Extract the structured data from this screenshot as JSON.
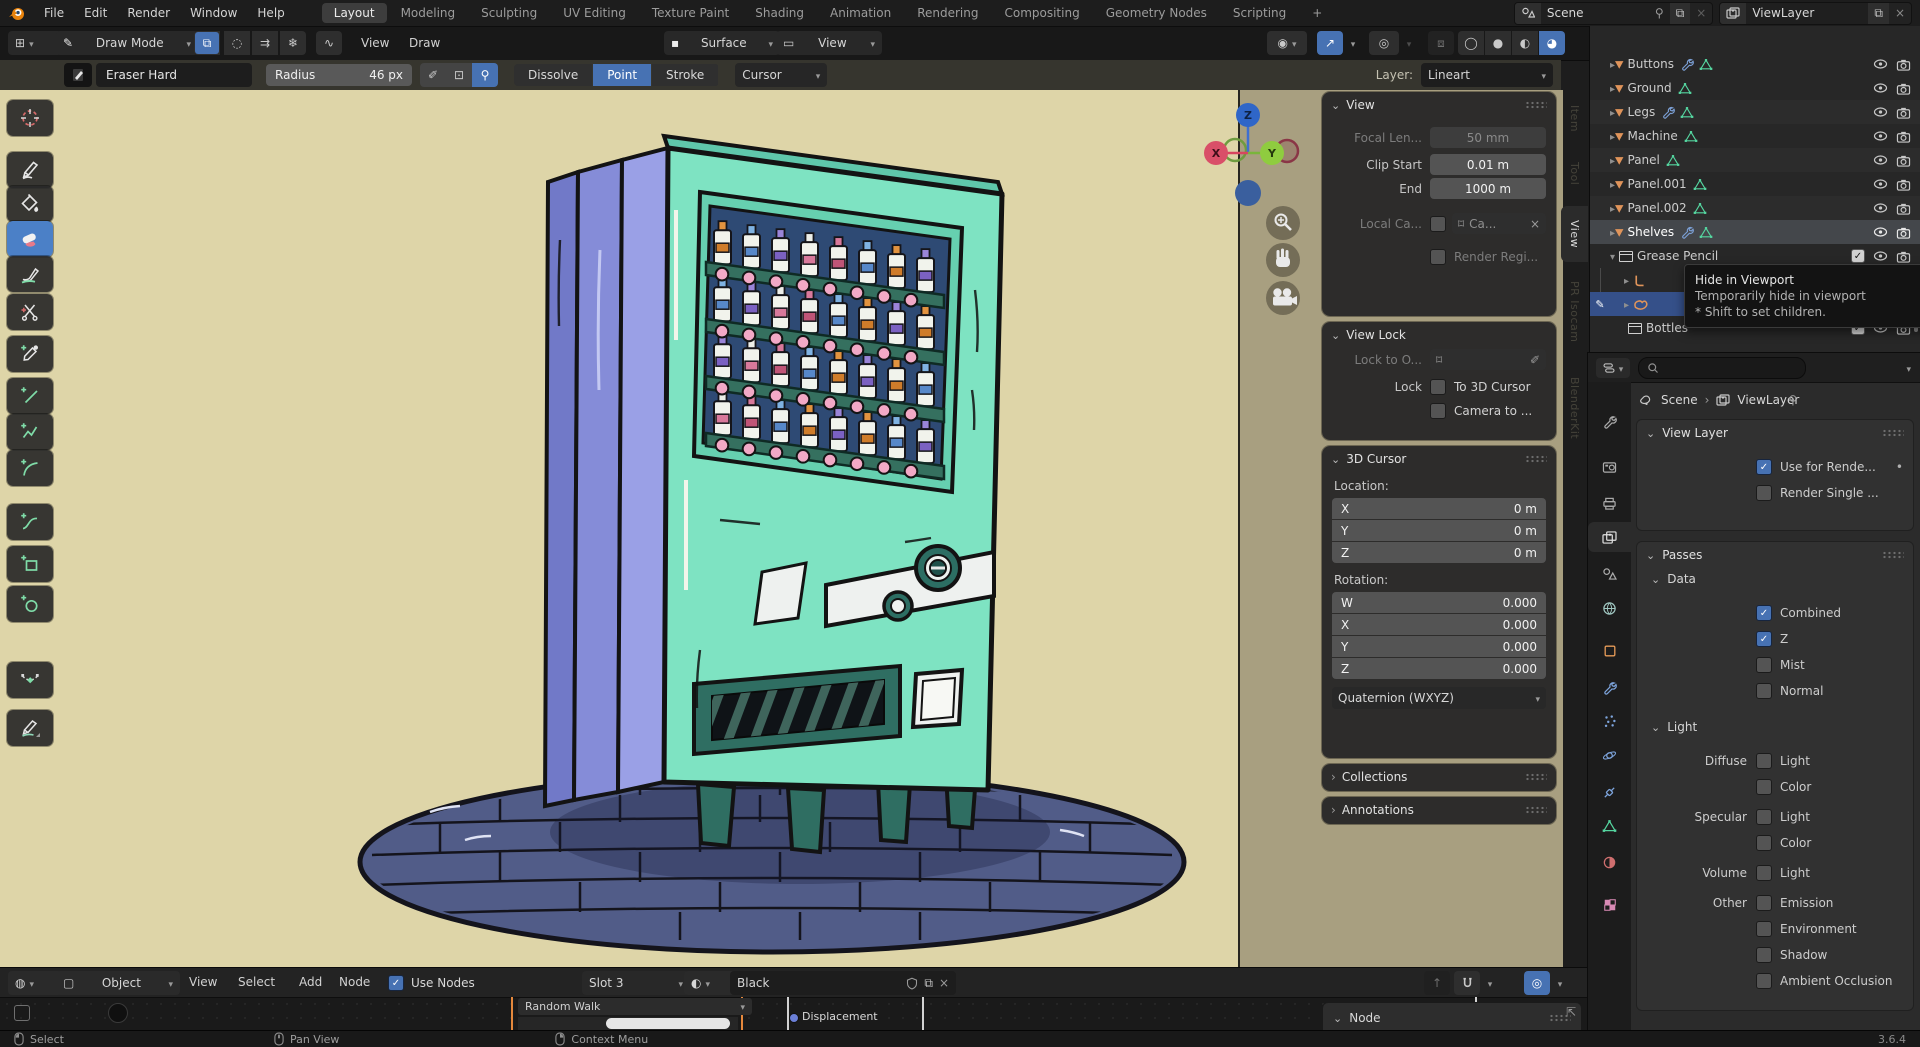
{
  "topbar": {
    "menus": [
      "File",
      "Edit",
      "Render",
      "Window",
      "Help"
    ],
    "workspaces": [
      "Layout",
      "Modeling",
      "Sculpting",
      "UV Editing",
      "Texture Paint",
      "Shading",
      "Animation",
      "Rendering",
      "Compositing",
      "Geometry Nodes",
      "Scripting"
    ],
    "active_workspace": "Layout",
    "add_tab": "+",
    "scene_name": "Scene",
    "view_layer_name": "ViewLayer"
  },
  "header": {
    "mode": "Draw Mode",
    "view_menu": "View",
    "draw_menu": "Draw",
    "placement_label": "Surface",
    "orientation_label": "View"
  },
  "tool": {
    "brush": "Eraser Hard",
    "radius_label": "Radius",
    "radius_value": "46 px",
    "eraser_modes": [
      "Dissolve",
      "Point",
      "Stroke"
    ],
    "active_eraser_mode": "Point",
    "cursor_label": "Cursor"
  },
  "viewport": {
    "layer_label": "Layer:",
    "layer_value": "Lineart",
    "axis_x": "X",
    "axis_y": "Y",
    "axis_z": "Z"
  },
  "side_tabs": {
    "items": [
      "Item",
      "Tool",
      "View",
      "PR Isocam",
      "BlenderKit"
    ],
    "active": "View"
  },
  "npanel": {
    "view": {
      "title": "View",
      "focal_label": "Focal Len...",
      "focal_value": "50 mm",
      "clip_start_label": "Clip Start",
      "clip_start_value": "0.01 m",
      "end_label": "End",
      "end_value": "1000 m",
      "local_camera_label": "Local Ca...",
      "local_camera_value": "Ca...",
      "render_region_label": "Render Regi..."
    },
    "view_lock": {
      "title": "View Lock",
      "lock_object_label": "Lock to O...",
      "lock_label": "Lock",
      "to_3d_cursor_label": "To 3D Cursor",
      "camera_to_label": "Camera to ..."
    },
    "cursor": {
      "title": "3D Cursor",
      "location_label": "Location:",
      "x_label": "X",
      "x_value": "0 m",
      "y_label": "Y",
      "y_value": "0 m",
      "z_label": "Z",
      "z_value": "0 m",
      "rotation_label": "Rotation:",
      "w_label": "W",
      "w_value": "0.000",
      "rx_label": "X",
      "rx_value": "0.000",
      "ry_label": "Y",
      "ry_value": "0.000",
      "rz_label": "Z",
      "rz_value": "0.000",
      "rotation_mode": "Quaternion (WXYZ)"
    },
    "collections_title": "Collections",
    "annotations_title": "Annotations"
  },
  "outliner": {
    "rows": [
      {
        "name": "Buttons"
      },
      {
        "name": "Ground"
      },
      {
        "name": "Legs"
      },
      {
        "name": "Machine"
      },
      {
        "name": "Panel"
      },
      {
        "name": "Panel.001"
      },
      {
        "name": "Panel.002"
      },
      {
        "name": "Shelves"
      },
      {
        "name": "Grease Pencil"
      },
      {
        "name": "Bottles"
      }
    ]
  },
  "tooltip": {
    "title": "Hide in Viewport",
    "line2": "Temporarily hide in viewport",
    "line3": "* Shift to set children."
  },
  "properties": {
    "scene": "Scene",
    "view_layer": "ViewLayer",
    "view_layer_panel": {
      "title": "View Layer",
      "use_for_rendering": "Use for Rende...",
      "render_single": "Render Single ..."
    },
    "passes": {
      "title": "Passes",
      "data_title": "Data",
      "combined": "Combined",
      "z": "Z",
      "mist": "Mist",
      "normal": "Normal",
      "light_title": "Light",
      "diffuse": "Diffuse",
      "specular": "Specular",
      "volume": "Volume",
      "other": "Other",
      "light": "Light",
      "color": "Color",
      "emission": "Emission",
      "environment": "Environment",
      "shadow": "Shadow",
      "ambient_occlusion": "Ambient Occlusion"
    }
  },
  "node_editor": {
    "object_mode": "Object",
    "menus": [
      "View",
      "Select",
      "Add",
      "Node"
    ],
    "use_nodes": "Use Nodes",
    "slot": "Slot 3",
    "material_name": "Black",
    "random_walk": "Random Walk",
    "displacement": "Displacement",
    "node_panel_title": "Node"
  },
  "statusbar": {
    "select": "Select",
    "pan": "Pan View",
    "context": "Context Menu",
    "version": "3.6.4"
  },
  "colors": {
    "accent": "#4772b3",
    "selection_blue": "#355089",
    "canvas": "#ded5a8",
    "viewport_outside": "#a89f80",
    "machine_mint": "#7ee3c2",
    "machine_purple": "#8a91d8",
    "floor": "#515c88"
  }
}
